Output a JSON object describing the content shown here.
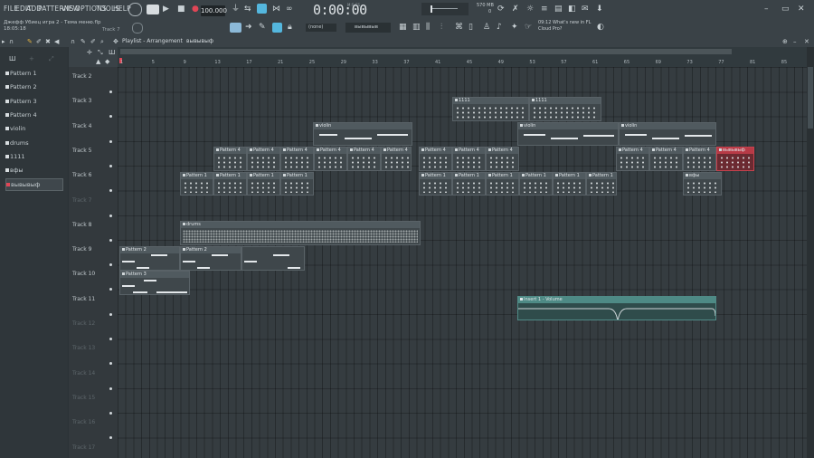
{
  "menu": [
    "FILE",
    "EDIT",
    "ADD",
    "PATTERNS",
    "VIEW",
    "OPTIONS",
    "TOOLS",
    "HELP"
  ],
  "transport": {
    "tempo": "100.000",
    "time": "0:00:00",
    "time_suffix": "M:S:CS",
    "memory": "570 MB",
    "memory_sub": "0"
  },
  "project": {
    "title": "Джефф Убиец игра 2 - Тема меню.flp",
    "clock": "18:05:18",
    "hint": "Track 7"
  },
  "news": {
    "time": "09:12",
    "text1": "What's new in FL",
    "text2": "Cloud Pro?"
  },
  "snap": {
    "value": "(none)"
  },
  "pattern_selector": "вывывыв",
  "playlist": {
    "title": "Playlist - Arrangement",
    "pattern": "вывывыф"
  },
  "browser": {
    "items": [
      {
        "label": "Pattern 1",
        "selected": false
      },
      {
        "label": "Pattern 2",
        "selected": false
      },
      {
        "label": "Pattern 3",
        "selected": false
      },
      {
        "label": "Pattern 4",
        "selected": false
      },
      {
        "label": "violin",
        "selected": false
      },
      {
        "label": "drums",
        "selected": false
      },
      {
        "label": "1111",
        "selected": false
      },
      {
        "label": "вфы",
        "selected": false
      },
      {
        "label": "вывывыф",
        "selected": true
      }
    ]
  },
  "ruler": {
    "numbers": [
      "1",
      "5",
      "9",
      "13",
      "17",
      "21",
      "25",
      "29",
      "33",
      "37",
      "41",
      "45",
      "49",
      "53",
      "57",
      "61",
      "65",
      "69",
      "73",
      "77",
      "81",
      "85"
    ]
  },
  "tracks": [
    {
      "label": "Track 2",
      "dim": false
    },
    {
      "label": "Track 3",
      "dim": false
    },
    {
      "label": "Track 4",
      "dim": false
    },
    {
      "label": "Track 5",
      "dim": false
    },
    {
      "label": "Track 6",
      "dim": false
    },
    {
      "label": "Track 7",
      "dim": true
    },
    {
      "label": "Track 8",
      "dim": false
    },
    {
      "label": "Track 9",
      "dim": false
    },
    {
      "label": "Track 10",
      "dim": false
    },
    {
      "label": "Track 11",
      "dim": false
    },
    {
      "label": "Track 12",
      "dim": true
    },
    {
      "label": "Track 13",
      "dim": true
    },
    {
      "label": "Track 14",
      "dim": true
    },
    {
      "label": "Track 15",
      "dim": true
    },
    {
      "label": "Track 16",
      "dim": true
    },
    {
      "label": "Track 17",
      "dim": true
    }
  ],
  "clip_names": {
    "p1": "Pattern 1",
    "p2": "Pattern 2",
    "p3": "Pattern 3",
    "p4": "Pattern 4",
    "violin": "violin",
    "drums": "drums",
    "n1111": "1111",
    "vfy": "вфы",
    "red": "вывывыф",
    "auto": "Insert 1 - Volume"
  },
  "colors": {
    "accent": "#54b7de",
    "selected_pattern": "#e04656",
    "automation": "#4e8a85"
  }
}
